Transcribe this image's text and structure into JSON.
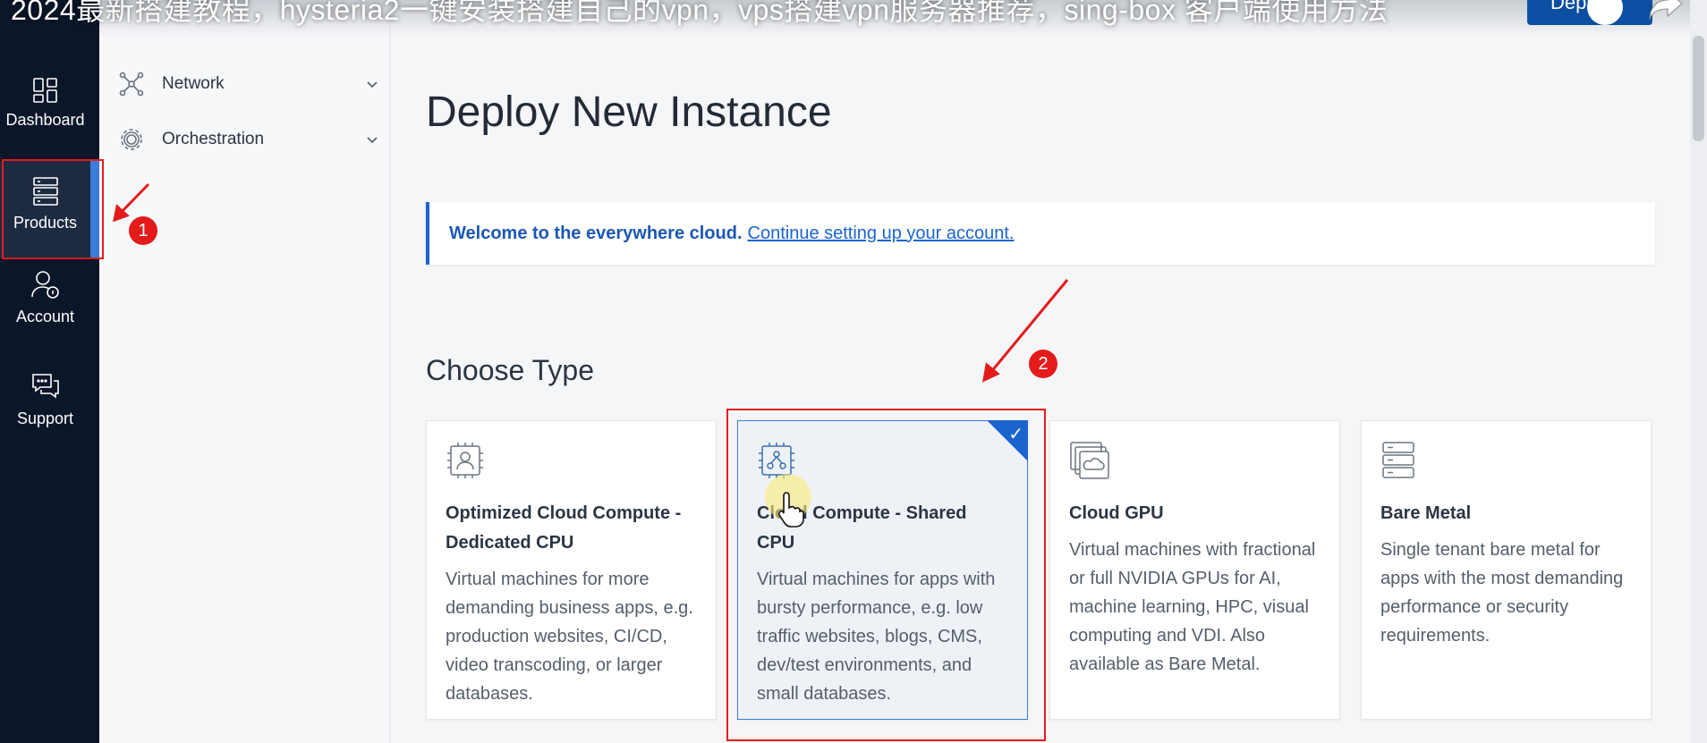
{
  "video_title": "2024最新搭建教程，hysteria2一键安装搭建自己的vpn，vps搭建vpn服务器推荐，sing-box 客户端使用方法",
  "top_bar": {
    "deploy_label": "Depl"
  },
  "rail": {
    "items": [
      {
        "label": "Dashboard",
        "icon": "dashboard-icon"
      },
      {
        "label": "Products",
        "icon": "server-stack-icon",
        "active": true
      },
      {
        "label": "Account",
        "icon": "user-lock-icon"
      },
      {
        "label": "Support",
        "icon": "chat-bubbles-icon"
      }
    ]
  },
  "subnav": {
    "items": [
      {
        "label": "Network",
        "icon": "network-nodes-icon"
      },
      {
        "label": "Orchestration",
        "icon": "orchestration-gear-icon"
      }
    ]
  },
  "main": {
    "title": "Deploy New Instance",
    "welcome": {
      "bold": "Welcome to the everywhere cloud.",
      "link": "Continue setting up your account."
    },
    "section_title": "Choose Type",
    "cards": [
      {
        "title": "Optimized Cloud Compute - Dedicated CPU",
        "desc": "Virtual machines for more demanding business apps, e.g. production websites, CI/CD, video transcoding, or larger databases.",
        "icon": "cpu-user-icon",
        "selected": false
      },
      {
        "title": "Cloud Compute - Shared CPU",
        "desc": "Virtual machines for apps with bursty performance, e.g. low traffic websites, blogs, CMS, dev/test environments, and small databases.",
        "icon": "cpu-share-icon",
        "selected": true
      },
      {
        "title": "Cloud GPU",
        "desc": "Virtual machines with fractional or full NVIDIA GPUs for AI, machine learning, HPC, visual computing and VDI. Also available as Bare Metal.",
        "icon": "gpu-cloud-icon",
        "selected": false
      },
      {
        "title": "Bare Metal",
        "desc": "Single tenant bare metal for apps with the most demanding performance or security requirements.",
        "icon": "bare-metal-server-icon",
        "selected": false
      }
    ]
  },
  "annotations": {
    "step1": "1",
    "step2": "2"
  },
  "colors": {
    "accent": "#1b64d0",
    "rail_bg": "#0b1629",
    "annotation_red": "#e31b1b"
  }
}
